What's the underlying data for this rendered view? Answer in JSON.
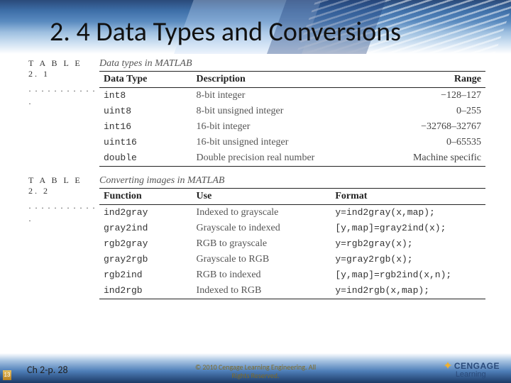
{
  "header": {
    "title": "2. 4 Data Types and Conversions"
  },
  "table1": {
    "label": "T A B L E  2. 1",
    "caption_pre": "Data types in ",
    "caption_em": "MATLAB",
    "headers": {
      "c1": "Data Type",
      "c2": "Description",
      "c3": "Range"
    },
    "rows": [
      {
        "type": "int8",
        "desc": "8-bit integer",
        "range": "−128–127"
      },
      {
        "type": "uint8",
        "desc": "8-bit unsigned integer",
        "range": "0–255"
      },
      {
        "type": "int16",
        "desc": "16-bit integer",
        "range": "−32768–32767"
      },
      {
        "type": "uint16",
        "desc": "16-bit unsigned integer",
        "range": "0–65535"
      },
      {
        "type": "double",
        "desc": "Double precision real number",
        "range": "Machine specific"
      }
    ]
  },
  "table2": {
    "label": "T A B L E  2. 2",
    "caption_pre": "Converting images in ",
    "caption_em": "MATLAB",
    "headers": {
      "c1": "Function",
      "c2": "Use",
      "c3": "Format"
    },
    "rows": [
      {
        "fn": "ind2gray",
        "use": "Indexed to grayscale",
        "fmt": "y=ind2gray(x,map);"
      },
      {
        "fn": "gray2ind",
        "use": "Grayscale to indexed",
        "fmt": "[y,map]=gray2ind(x);"
      },
      {
        "fn": "rgb2gray",
        "use": "RGB to grayscale",
        "fmt": "y=rgb2gray(x);"
      },
      {
        "fn": "gray2rgb",
        "use": "Grayscale to RGB",
        "fmt": "y=gray2rgb(x);"
      },
      {
        "fn": "rgb2ind",
        "use": "RGB to indexed",
        "fmt": "[y,map]=rgb2ind(x,n);"
      },
      {
        "fn": "ind2rgb",
        "use": "Indexed to RGB",
        "fmt": "y=ind2rgb(x,map);"
      }
    ]
  },
  "footer": {
    "page_num": "13",
    "page_ref": "Ch 2-p. 28",
    "copyright_l1": "© 2010 Cengage Learning Engineering. All",
    "copyright_l2": "Rights Reserved.",
    "logo_top": "CENGAGE",
    "logo_bot": "Learning"
  }
}
